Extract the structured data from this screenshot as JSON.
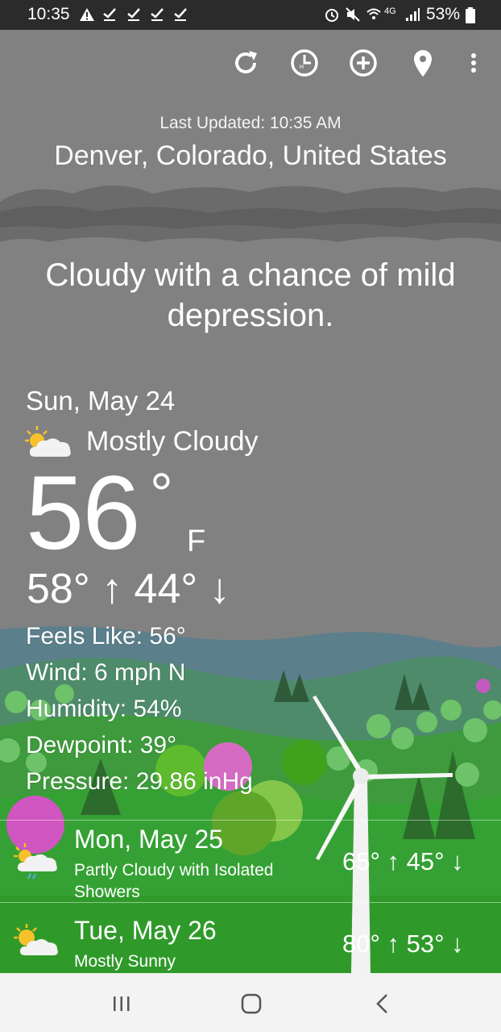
{
  "status_bar": {
    "time": "10:35",
    "battery": "53%",
    "network": "4G"
  },
  "toolbar": {
    "refresh_icon": "refresh-icon",
    "history_icon": "history-icon",
    "add_icon": "add-location-icon",
    "location_icon": "location-pin-icon",
    "menu_icon": "overflow-menu-icon"
  },
  "header": {
    "last_updated": "Last Updated: 10:35 AM",
    "location": "Denver, Colorado, United States"
  },
  "slogan": "Cloudy with a chance of mild depression.",
  "current": {
    "date": "Sun, May 24",
    "condition": "Mostly Cloudy",
    "temp": "56",
    "degree": "°",
    "unit": "F",
    "hilo": "58° ↑ 44° ↓",
    "feels_like": "Feels Like: 56°",
    "wind": "Wind: 6 mph N",
    "humidity": "Humidity: 54%",
    "dewpoint": "Dewpoint: 39°",
    "pressure": "Pressure: 29.86 inHg"
  },
  "forecast": [
    {
      "date": "Mon, May 25",
      "desc": "Partly Cloudy with Isolated Showers",
      "hilo": "65° ↑ 45° ↓",
      "icon": "partly-cloudy-showers-icon"
    },
    {
      "date": "Tue, May 26",
      "desc": "Mostly Sunny",
      "hilo": "80° ↑ 53° ↓",
      "icon": "mostly-sunny-icon"
    }
  ],
  "colors": {
    "sky": "#808080",
    "grass": "#2f9a2a",
    "status_bar": "#2b2b2b"
  }
}
